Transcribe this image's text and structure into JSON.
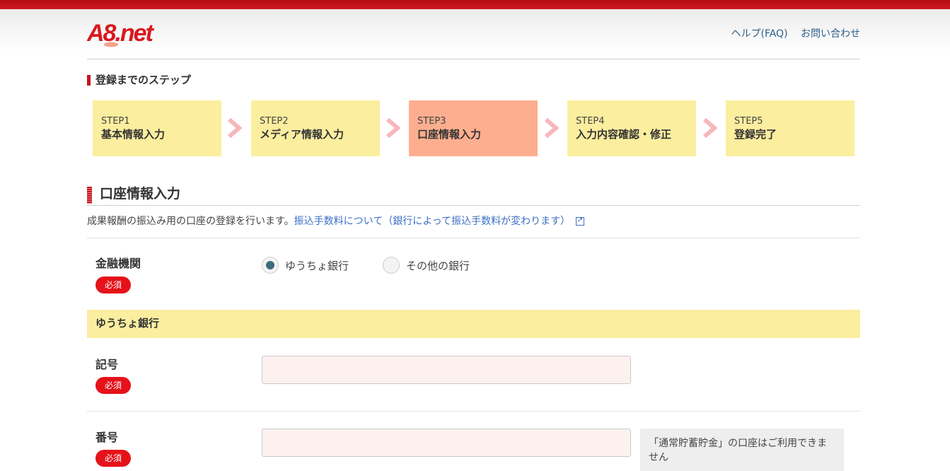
{
  "header": {
    "logo_text": "A8.net",
    "links": [
      "ヘルプ(FAQ)",
      "お問い合わせ"
    ]
  },
  "steps": {
    "title": "登録までのステップ",
    "items": [
      {
        "num": "STEP1",
        "name": "基本情報入力"
      },
      {
        "num": "STEP2",
        "name": "メディア情報入力"
      },
      {
        "num": "STEP3",
        "name": "口座情報入力"
      },
      {
        "num": "STEP4",
        "name": "入力内容確認・修正"
      },
      {
        "num": "STEP5",
        "name": "登録完了"
      }
    ],
    "active_index": 2
  },
  "section": {
    "title": "口座情報入力",
    "description": "成果報酬の振込み用の口座の登録を行います。",
    "link_text": "振込手数料について（銀行によって振込手数料が変わります）"
  },
  "form": {
    "required_label": "必須",
    "bank": {
      "label": "金融機関",
      "options": [
        "ゆうちょ銀行",
        "その他の銀行"
      ],
      "selected": "ゆうちょ銀行"
    },
    "subheading": "ゆうちょ銀行",
    "kigou": {
      "label": "記号",
      "value": ""
    },
    "bangou": {
      "label": "番号",
      "value": ""
    },
    "note": "「通常貯蓄貯金」の口座はご利用できません"
  },
  "colors": {
    "brand_red": "#c4161c",
    "step_bg": "#fcee9f",
    "step_active_bg": "#fdae8f",
    "link": "#3b6fc4"
  }
}
